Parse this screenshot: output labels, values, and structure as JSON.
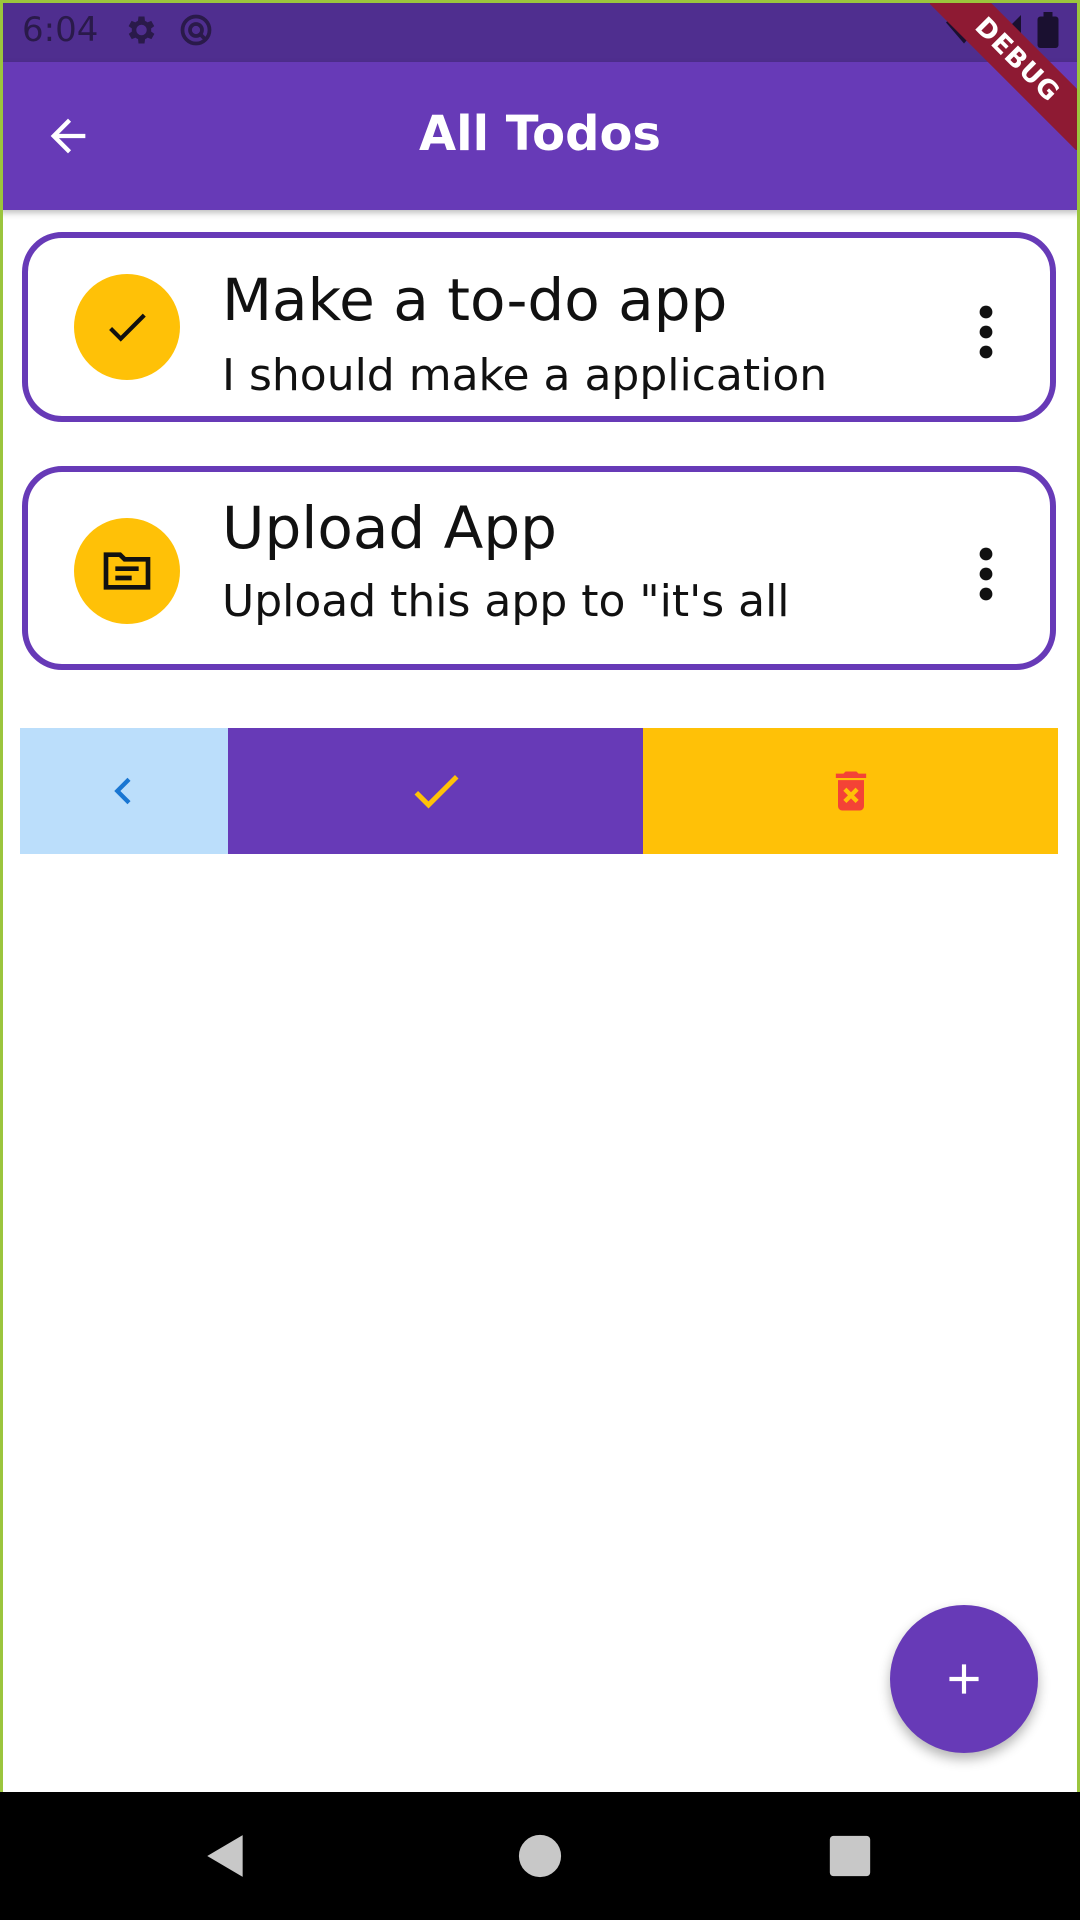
{
  "status_bar": {
    "time": "6:04"
  },
  "app_bar": {
    "title": "All Todos",
    "back_icon": "arrow-back-icon"
  },
  "debug_banner": "DEBUG",
  "todos": [
    {
      "title": "Make a to-do app",
      "description": "I should make a application",
      "icon": "check-icon"
    },
    {
      "title": "Upload App",
      "description": "Upload this app to \"it's all",
      "icon": "description-icon"
    }
  ],
  "actions": {
    "back_icon": "chevron-left-icon",
    "complete_icon": "check-icon",
    "delete_icon": "delete-forever-icon"
  },
  "fab": {
    "icon": "plus-icon"
  },
  "colors": {
    "primary": "#673ab7",
    "status_bar": "#4f2e8f",
    "accent": "#ffc107",
    "light_blue": "#bbdefb",
    "blue": "#1976d2",
    "red": "#f44336"
  }
}
